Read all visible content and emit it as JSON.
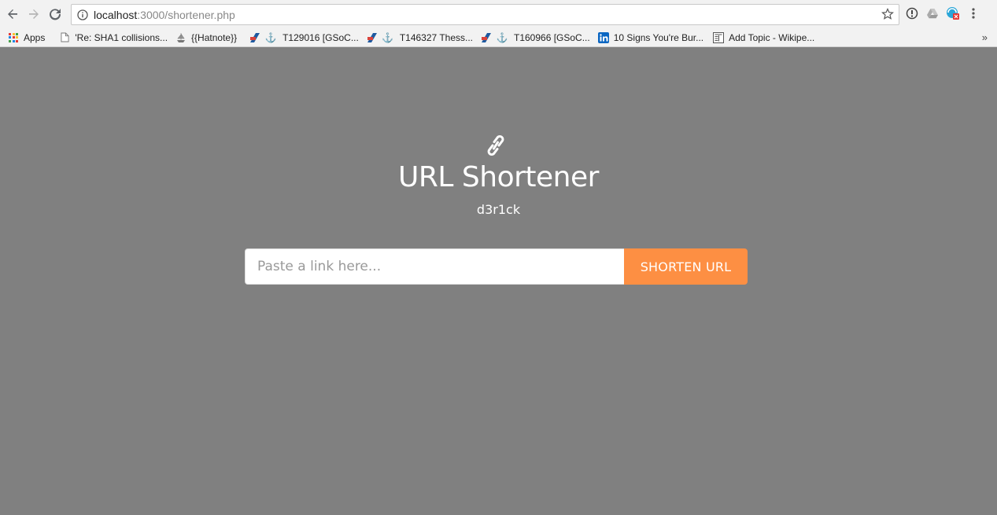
{
  "browser": {
    "url_host": "localhost",
    "url_path": ":3000/shortener.php",
    "bookmarks": [
      {
        "label": "Apps",
        "icon": "apps-grid-icon"
      },
      {
        "label": "'Re: SHA1 collisions...",
        "icon": "page-icon"
      },
      {
        "label": "{{Hatnote}}",
        "icon": "ship-icon"
      },
      {
        "label": "T129016 [GSoC...",
        "icon": "phabricator-icon"
      },
      {
        "label": "T146327 Thess...",
        "icon": "phabricator-icon"
      },
      {
        "label": "T160966 [GSoC...",
        "icon": "phabricator-icon"
      },
      {
        "label": "10 Signs You're Bur...",
        "icon": "linkedin-icon"
      },
      {
        "label": "Add Topic - Wikipe...",
        "icon": "wiki-icon"
      }
    ],
    "bookmarks_more": "»"
  },
  "page": {
    "icon": "link-icon",
    "title": "URL Shortener",
    "subtitle": "d3r1ck",
    "input_placeholder": "Paste a link here...",
    "input_value": "",
    "button_label": "SHORTEN URL"
  },
  "colors": {
    "background": "#808080",
    "button": "#fd8f43",
    "text": "#ffffff"
  }
}
